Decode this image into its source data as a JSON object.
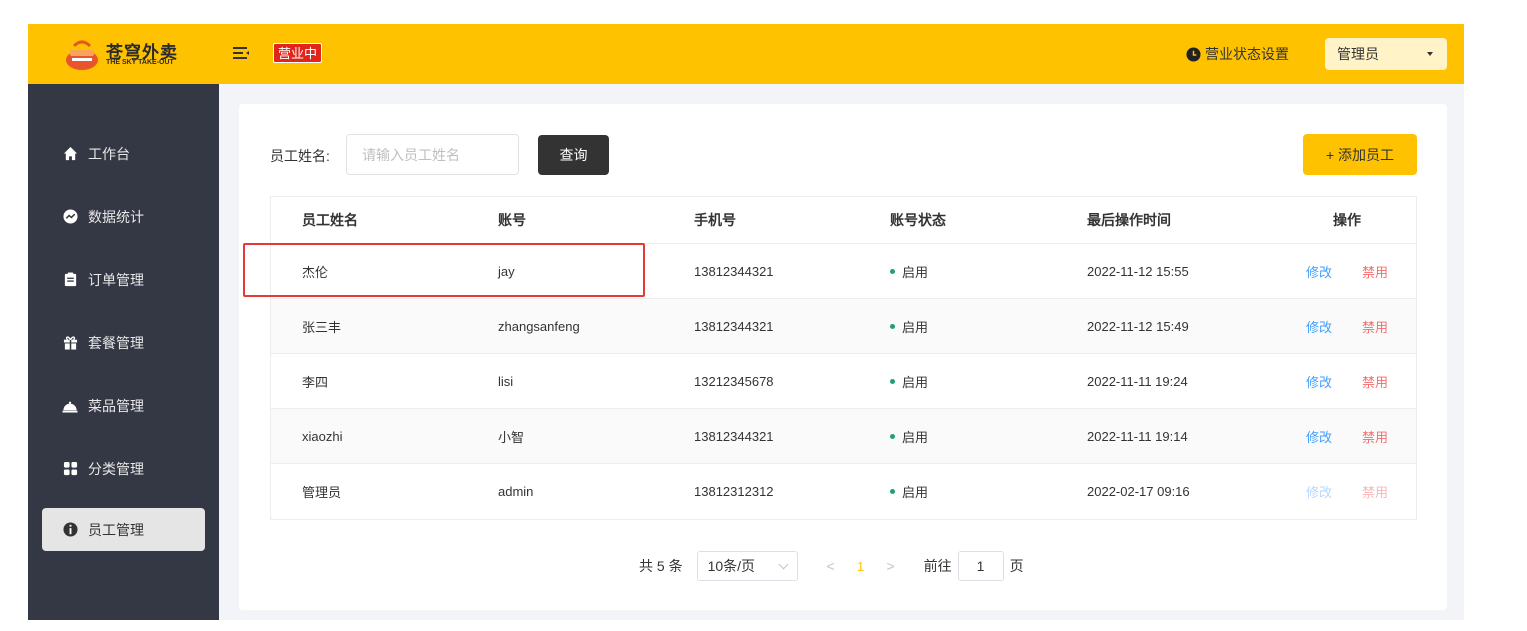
{
  "brand": {
    "name_cn": "苍穹外卖",
    "name_en": "THE SKY TAKE-OUT"
  },
  "header": {
    "status_tag": "营业中",
    "shop_status_label": "营业状态设置",
    "user_label": "管理员"
  },
  "sidebar": {
    "items": [
      {
        "label": "工作台",
        "icon": "home-icon",
        "active": false
      },
      {
        "label": "数据统计",
        "icon": "chart-icon",
        "active": false
      },
      {
        "label": "订单管理",
        "icon": "clipboard-icon",
        "active": false
      },
      {
        "label": "套餐管理",
        "icon": "gift-icon",
        "active": false
      },
      {
        "label": "菜品管理",
        "icon": "dish-icon",
        "active": false
      },
      {
        "label": "分类管理",
        "icon": "grid-icon",
        "active": false
      },
      {
        "label": "员工管理",
        "icon": "employee-icon",
        "active": true
      }
    ]
  },
  "search": {
    "label": "员工姓名:",
    "placeholder": "请输入员工姓名",
    "value": "",
    "query_label": "查询"
  },
  "toolbar": {
    "add_label": "+ 添加员工"
  },
  "table": {
    "headers": [
      "员工姓名",
      "账号",
      "手机号",
      "账号状态",
      "最后操作时间",
      "操作"
    ],
    "rows": [
      {
        "name": "杰伦",
        "account": "jay",
        "phone": "13812344321",
        "status": "启用",
        "updated": "2022-11-12 15:55",
        "edit": "修改",
        "ban": "禁用"
      },
      {
        "name": "张三丰",
        "account": "zhangsanfeng",
        "phone": "13812344321",
        "status": "启用",
        "updated": "2022-11-12 15:49",
        "edit": "修改",
        "ban": "禁用"
      },
      {
        "name": "李四",
        "account": "lisi",
        "phone": "13212345678",
        "status": "启用",
        "updated": "2022-11-11 19:24",
        "edit": "修改",
        "ban": "禁用"
      },
      {
        "name": "xiaozhi",
        "account": "小智",
        "phone": "13812344321",
        "status": "启用",
        "updated": "2022-11-11 19:14",
        "edit": "修改",
        "ban": "禁用"
      },
      {
        "name": "管理员",
        "account": "admin",
        "phone": "13812312312",
        "status": "启用",
        "updated": "2022-02-17 09:16",
        "edit": "修改",
        "ban": "禁用"
      }
    ]
  },
  "pagination": {
    "total_text": "共 5 条",
    "page_size": "10条/页",
    "prev": "<",
    "current_page": "1",
    "next": ">",
    "goto_label": "前往",
    "goto_value": "1",
    "page_unit": "页"
  },
  "colors": {
    "brand": "#ffc200",
    "sidebar": "#343744",
    "status_dot": "#22a06b",
    "edit_link": "#419eff",
    "ban_link": "#f56c6c",
    "highlight": "#e53935"
  }
}
